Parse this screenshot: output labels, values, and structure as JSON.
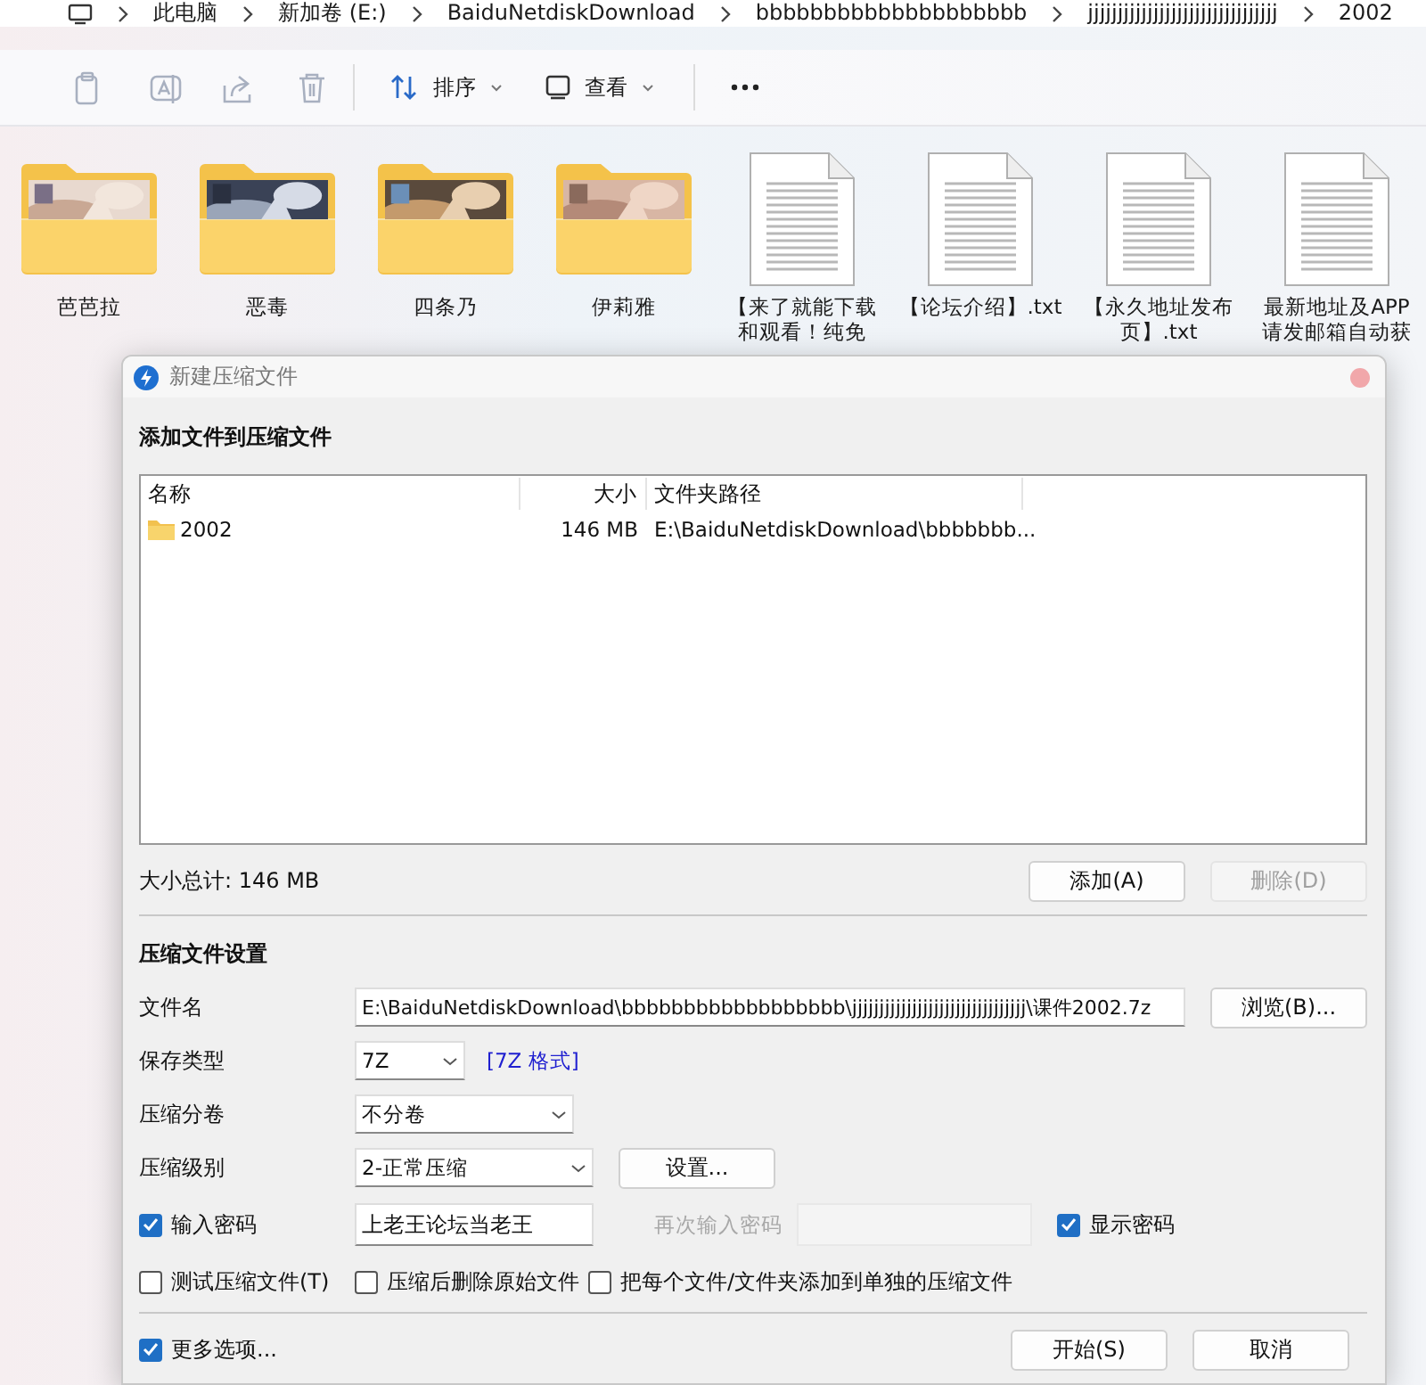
{
  "breadcrumb": [
    {
      "label": "此电脑"
    },
    {
      "label": "新加卷 (E:)"
    },
    {
      "label": "BaiduNetdiskDownload"
    },
    {
      "label": "bbbbbbbbbbbbbbbbbbbb"
    },
    {
      "label": "jjjjjjjjjjjjjjjjjjjjjjjjjjjjjjjj"
    },
    {
      "label": "2002"
    }
  ],
  "toolbar": {
    "sort": {
      "label": "排序"
    },
    "view": {
      "label": "查看"
    }
  },
  "files": [
    {
      "kind": "folder",
      "name": [
        "芭芭拉"
      ]
    },
    {
      "kind": "folder",
      "name": [
        "恶毒"
      ]
    },
    {
      "kind": "folder",
      "name": [
        "四条乃"
      ]
    },
    {
      "kind": "folder",
      "name": [
        "伊莉雅"
      ]
    },
    {
      "kind": "document",
      "name": [
        "【来了就能下载",
        "和观看！纯免"
      ]
    },
    {
      "kind": "document",
      "name": [
        "【论坛介绍】.txt"
      ]
    },
    {
      "kind": "document",
      "name": [
        "【永久地址发布",
        "页】.txt"
      ]
    },
    {
      "kind": "document",
      "name": [
        "最新地址及APP",
        "请发邮箱自动获"
      ]
    }
  ],
  "dialog": {
    "title": "新建压缩文件",
    "add_section": {
      "heading": "添加文件到压缩文件",
      "columns": [
        "名称",
        "大小",
        "文件夹路径"
      ],
      "rows": [
        {
          "name": "2002",
          "size": "146 MB",
          "path": "E:\\BaiduNetdiskDownload\\bbbbbbb...",
          "selected": false
        }
      ],
      "total": "大小总计: 146 MB",
      "buttons": [
        {
          "label": "添加(A)",
          "disabled": false
        },
        {
          "label": "删除(D)",
          "disabled": true
        }
      ]
    },
    "settings": {
      "heading": "压缩文件设置",
      "filename": {
        "label": "文件名",
        "value": "E:\\BaiduNetdiskDownload\\bbbbbbbbbbbbbbbbbb\\jjjjjjjjjjjjjjjjjjjjjjjjjjjjjjjj\\课件2002.7z",
        "button": "浏览(B)..."
      },
      "format": {
        "label": "保存类型",
        "value": "7Z",
        "link": "[7Z 格式]"
      },
      "split": {
        "label": "压缩分卷",
        "value": "不分卷"
      },
      "level": {
        "label": "压缩级别",
        "value": "2-正常压缩",
        "button": "设置..."
      },
      "password": {
        "label": "输入密码",
        "checked": true,
        "value": "上老王论坛当老王",
        "confirm_label": "再次输入密码",
        "confirm_disabled": true,
        "show_label": "显示密码",
        "show_checked": true
      },
      "options": [
        {
          "label": "测试压缩文件(T)",
          "checked": false
        },
        {
          "label": "压缩后删除原始文件",
          "checked": false
        },
        {
          "label": "把每个文件/文件夹添加到单独的压缩文件",
          "checked": false
        }
      ],
      "more_options": {
        "label": "更多选项...",
        "checked": true
      },
      "buttons": [
        {
          "label": "开始(S)"
        },
        {
          "label": "取消"
        }
      ]
    }
  }
}
